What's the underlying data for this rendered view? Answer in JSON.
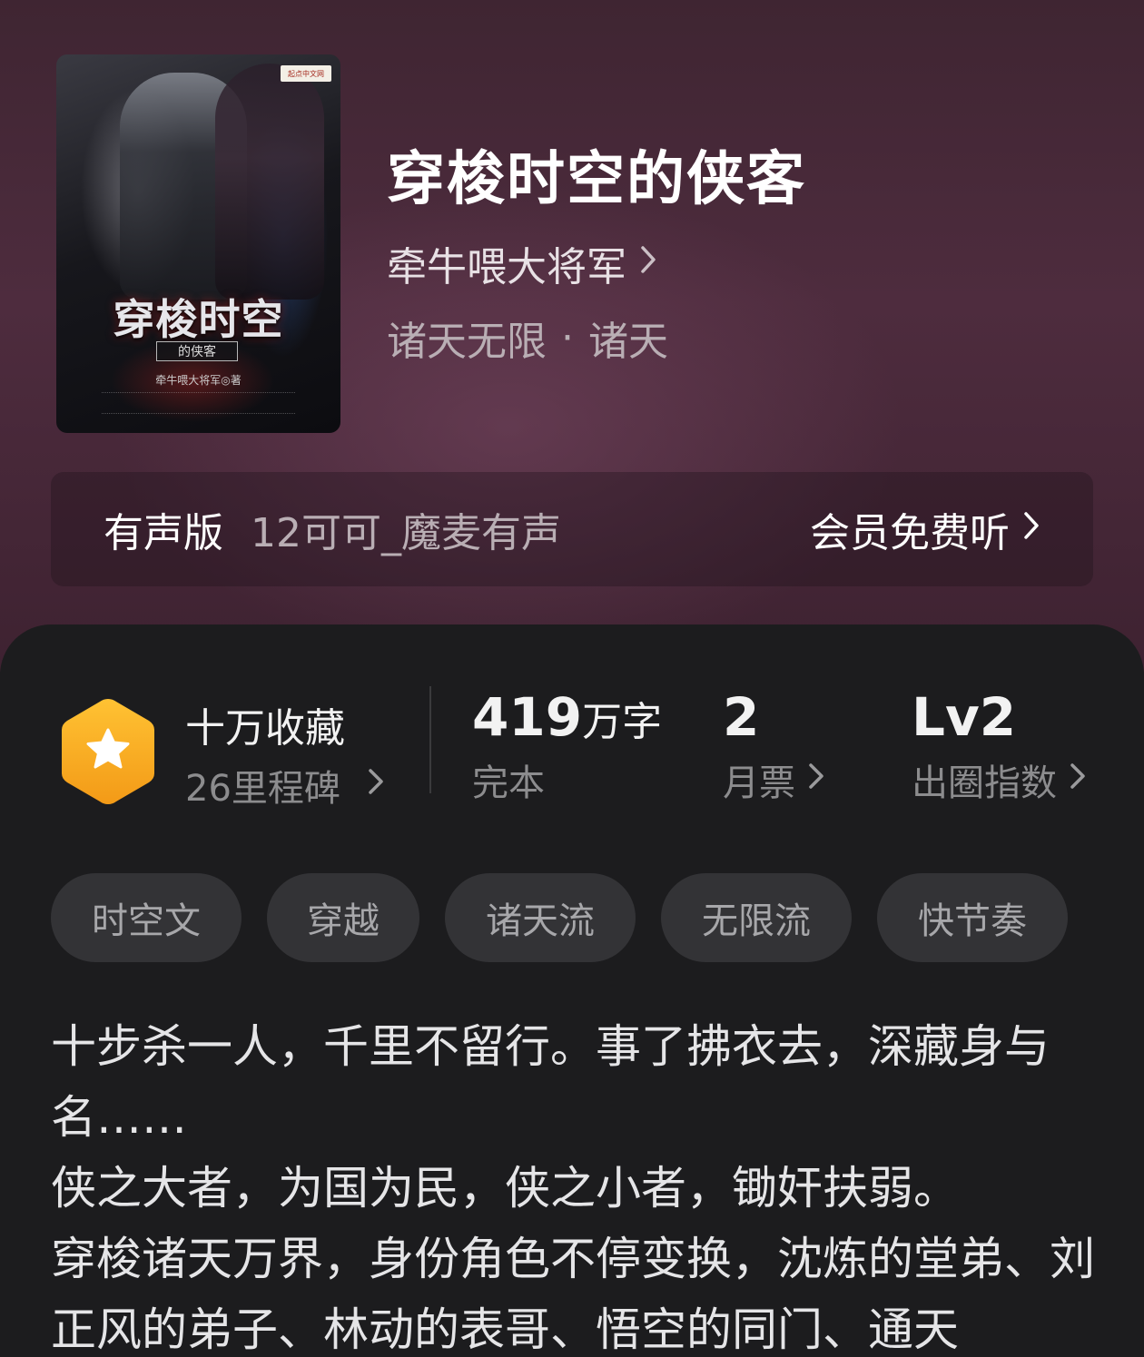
{
  "book": {
    "title": "穿梭时空的侠客",
    "author": "牵牛喂大将军",
    "genre_main": "诸天无限",
    "genre_separator": "·",
    "genre_sub": "诸天"
  },
  "cover": {
    "publisher_logo_text": "起点中文网",
    "title_text": "穿梭时空",
    "subtitle_text": "的侠客",
    "author_text": "牵牛喂大将军◎著"
  },
  "audio": {
    "label": "有声版",
    "narrator": "12可可_魔麦有声",
    "cta": "会员免费听"
  },
  "stats": {
    "collection": {
      "title": "十万收藏",
      "subtitle": "26里程碑"
    },
    "words": {
      "number": "419",
      "unit": "万字",
      "status": "完本"
    },
    "monthly_ticket": {
      "number": "2",
      "label": "月票"
    },
    "influence": {
      "value": "Lv2",
      "label": "出圈指数"
    }
  },
  "tags": [
    "时空文",
    "穿越",
    "诸天流",
    "无限流",
    "快节奏"
  ],
  "description": [
    "十步杀一人，千里不留行。事了拂衣去，深藏身与名……",
    "侠之大者，为国为民，侠之小者，锄奸扶弱。",
    "穿梭诸天万界，身份角色不停变换，沈炼的堂弟、刘正风的弟子、林动的表哥、悟空的同门、通天"
  ],
  "colors": {
    "hero_bg": "#4e2c3e",
    "panel_bg": "#1c1c1e",
    "badge_orange": "#f6a623",
    "tag_bg": "#333336"
  },
  "icons": {
    "badge": "star-hexagon-icon",
    "chevron": "chevron-right-icon"
  }
}
